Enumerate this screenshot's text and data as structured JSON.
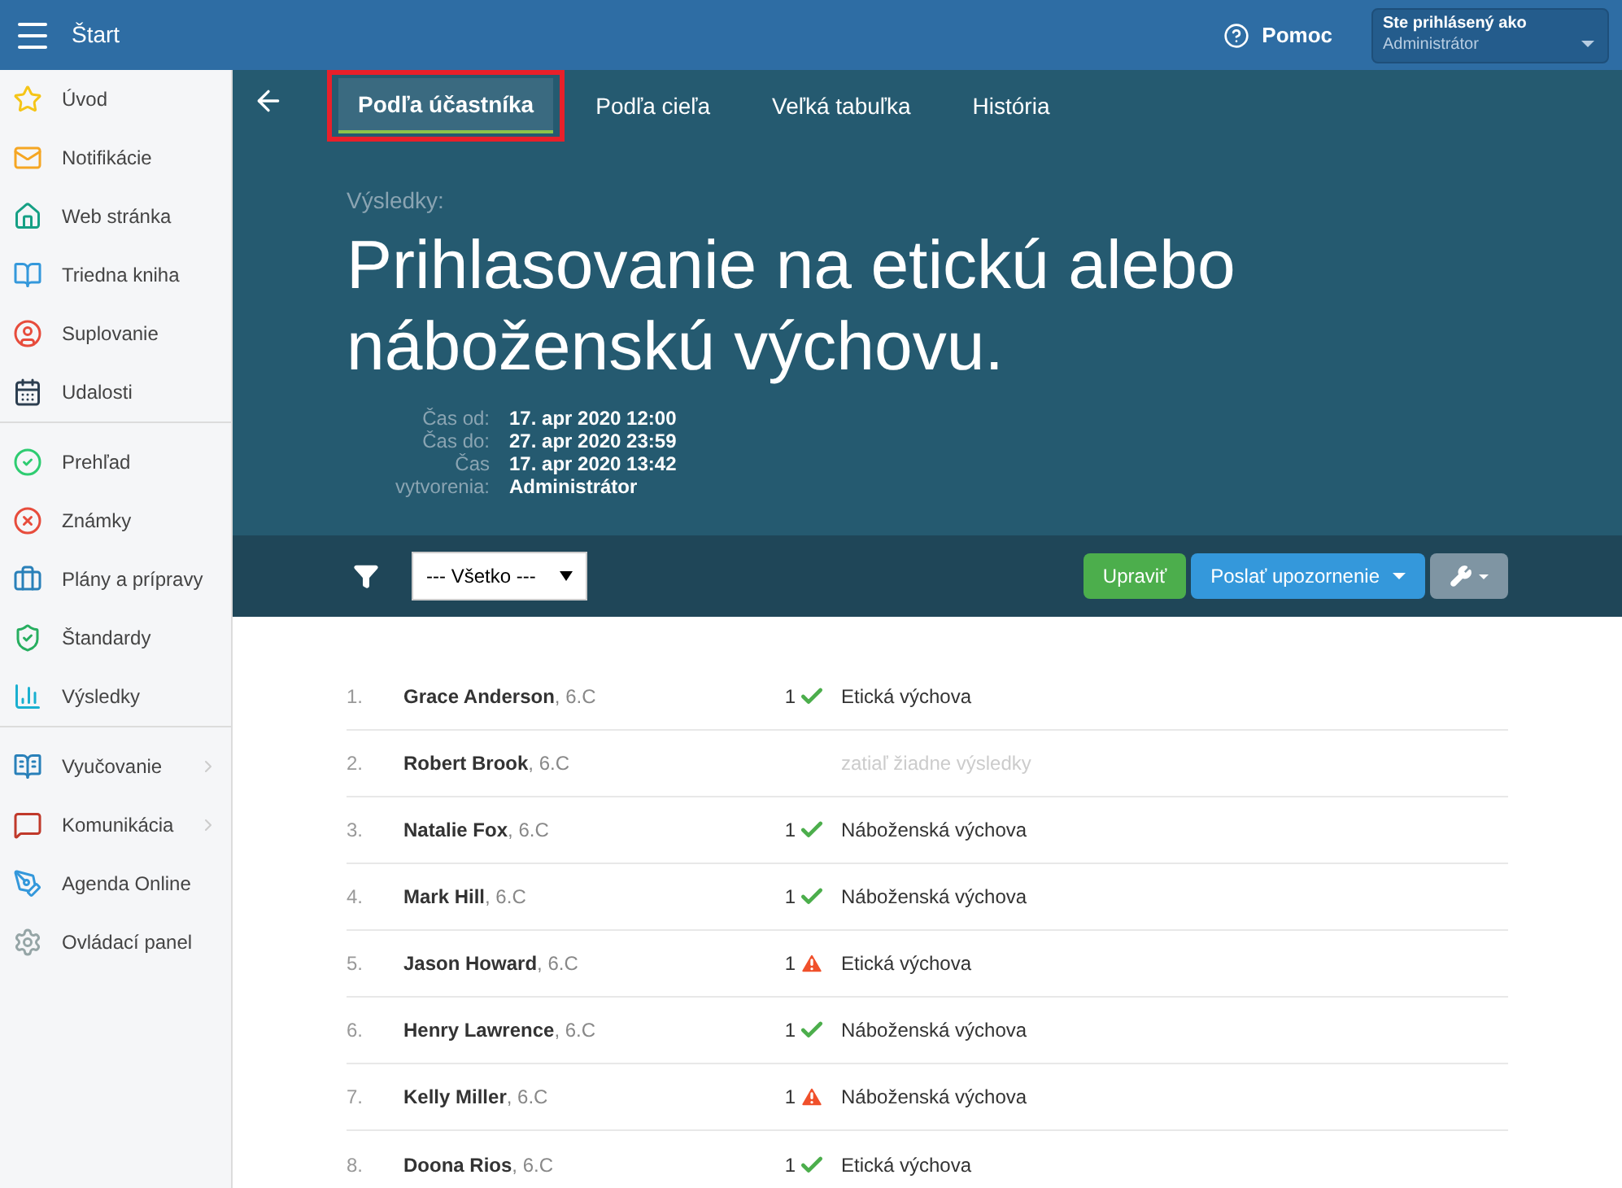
{
  "topbar": {
    "title": "Štart",
    "help": "Pomoc",
    "user_label": "Ste prihlásený ako",
    "user_name": "Administrátor"
  },
  "sidebar": {
    "groups": [
      [
        {
          "label": "Úvod",
          "kind": "link"
        },
        {
          "label": "Notifikácie",
          "kind": "link"
        },
        {
          "label": "Web stránka",
          "kind": "link"
        },
        {
          "label": "Triedna kniha",
          "kind": "link"
        },
        {
          "label": "Suplovanie",
          "kind": "link"
        },
        {
          "label": "Udalosti",
          "kind": "link"
        }
      ],
      [
        {
          "label": "Prehľad",
          "kind": "link"
        },
        {
          "label": "Známky",
          "kind": "link"
        },
        {
          "label": "Plány a prípravy",
          "kind": "link"
        },
        {
          "label": "Štandardy",
          "kind": "link"
        },
        {
          "label": "Výsledky",
          "kind": "link"
        }
      ],
      [
        {
          "label": "Vyučovanie",
          "kind": "submenu"
        },
        {
          "label": "Komunikácia",
          "kind": "submenu"
        },
        {
          "label": "Agenda Online",
          "kind": "link"
        },
        {
          "label": "Ovládací panel",
          "kind": "link"
        }
      ]
    ]
  },
  "tabs": [
    {
      "label": "Podľa účastníka",
      "selected": true,
      "highlighted": true
    },
    {
      "label": "Podľa cieľa",
      "selected": false,
      "highlighted": false
    },
    {
      "label": "Veľká tabuľka",
      "selected": false,
      "highlighted": false
    },
    {
      "label": "História",
      "selected": false,
      "highlighted": false
    }
  ],
  "header": {
    "caption": "Výsledky:",
    "title": "Prihlasovanie na etickú alebo náboženskú výchovu.",
    "meta": [
      {
        "label": "Čas od:",
        "value": "17. apr 2020 12:00"
      },
      {
        "label": "Čas do:",
        "value": "27. apr 2020 23:59"
      },
      {
        "label": "Čas vytvorenia:",
        "value": "17. apr 2020 13:42\nAdministrátor"
      }
    ]
  },
  "toolbar": {
    "filter": "--- Všetko ---",
    "edit": "Upraviť",
    "notify": "Poslať upozornenie"
  },
  "rows": [
    {
      "index": "1.",
      "name": "Grace Anderson",
      "class": ", 6.C",
      "count": "1",
      "kind": "ok",
      "result": "Etická výchova"
    },
    {
      "index": "2.",
      "name": "Robert Brook",
      "class": ", 6.C",
      "kind": "none",
      "result": "zatiaľ žiadne výsledky"
    },
    {
      "index": "3.",
      "name": "Natalie Fox",
      "class": ", 6.C",
      "count": "1",
      "kind": "ok",
      "result": "Náboženská výchova"
    },
    {
      "index": "4.",
      "name": "Mark Hill",
      "class": ", 6.C",
      "count": "1",
      "kind": "ok",
      "result": "Náboženská výchova"
    },
    {
      "index": "5.",
      "name": "Jason Howard",
      "class": ", 6.C",
      "count": "1",
      "kind": "warning",
      "result": "Etická výchova"
    },
    {
      "index": "6.",
      "name": "Henry Lawrence",
      "class": ", 6.C",
      "count": "1",
      "kind": "ok",
      "result": "Náboženská výchova"
    },
    {
      "index": "7.",
      "name": "Kelly Miller",
      "class": ", 6.C",
      "count": "1",
      "kind": "warning",
      "result": "Náboženská výchova"
    },
    {
      "index": "8.",
      "name": "Doona Rios",
      "class": ", 6.C",
      "count": "1",
      "kind": "ok",
      "result": "Etická výchova"
    }
  ]
}
